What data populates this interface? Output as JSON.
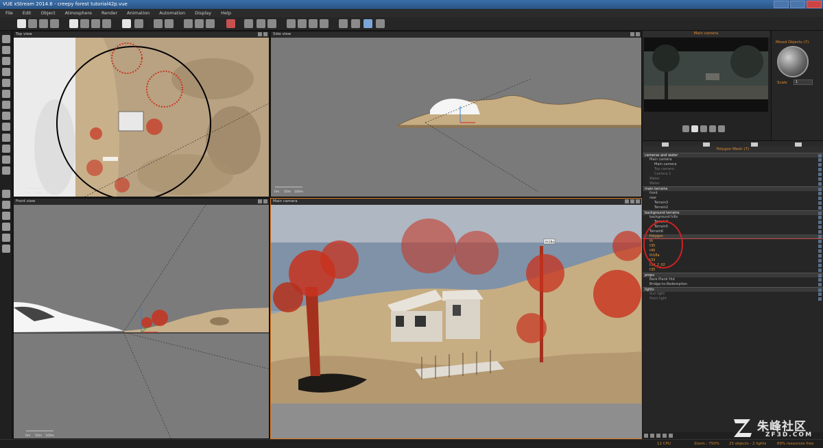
{
  "window": {
    "title": "VUE xStream 2014.6 - creepy forest tutorial42p.vue"
  },
  "menu": [
    "File",
    "Edit",
    "Object",
    "Atmosphere",
    "Render",
    "Animation",
    "Automation",
    "Display",
    "Help"
  ],
  "viewports": {
    "top": {
      "label": "Top view",
      "scale": [
        "0m",
        "50m",
        "100m"
      ]
    },
    "side": {
      "label": "Side view",
      "scale": [
        "0m",
        "50m",
        "100m"
      ]
    },
    "front": {
      "label": "Front view",
      "scale": [
        "0m",
        "50m",
        "100m"
      ]
    },
    "main": {
      "label": "Main camera",
      "object_tag": "th18a"
    }
  },
  "camera_panel": {
    "title": "Main camera"
  },
  "material_panel": {
    "title": "Mixed Objects (7)",
    "scale_label": "Scale",
    "scale_value": "1"
  },
  "object_panel": {
    "title": "Polygon Mesh (7)",
    "rows": [
      {
        "text": "cameras and water",
        "kind": "group",
        "indent": 0
      },
      {
        "text": "Main camera",
        "kind": "item",
        "indent": 1
      },
      {
        "text": "Main camera",
        "kind": "item",
        "indent": 2
      },
      {
        "text": "Top camera",
        "kind": "dim",
        "indent": 2
      },
      {
        "text": "Camera 1",
        "kind": "dim",
        "indent": 2
      },
      {
        "text": "Water",
        "kind": "dim",
        "indent": 1
      },
      {
        "text": "Water",
        "kind": "dim",
        "indent": 1
      },
      {
        "text": "main terrains",
        "kind": "group",
        "indent": 0
      },
      {
        "text": "front",
        "kind": "item",
        "indent": 1
      },
      {
        "text": "rear",
        "kind": "item",
        "indent": 1
      },
      {
        "text": "Terrain3",
        "kind": "item",
        "indent": 2
      },
      {
        "text": "Terrain2",
        "kind": "item",
        "indent": 2
      },
      {
        "text": "background terrains",
        "kind": "group",
        "indent": 0
      },
      {
        "text": "background hills",
        "kind": "item",
        "indent": 1
      },
      {
        "text": "Terrain4",
        "kind": "item",
        "indent": 2
      },
      {
        "text": "Terrain5",
        "kind": "item",
        "indent": 2
      },
      {
        "text": "Terrain6",
        "kind": "item",
        "indent": 1
      },
      {
        "text": "Polygon",
        "kind": "cur",
        "indent": 1
      },
      {
        "text": "th",
        "kind": "sel",
        "indent": 1
      },
      {
        "text": "t35",
        "kind": "sel",
        "indent": 1
      },
      {
        "text": "t40",
        "kind": "sel",
        "indent": 1
      },
      {
        "text": "th18a",
        "kind": "sel",
        "indent": 1
      },
      {
        "text": "t33",
        "kind": "sel",
        "indent": 1
      },
      {
        "text": "t3d_2_02",
        "kind": "sel",
        "indent": 1
      },
      {
        "text": "t35",
        "kind": "sel",
        "indent": 1
      },
      {
        "text": "props",
        "kind": "group",
        "indent": 0
      },
      {
        "text": "Bare Plank Hut",
        "kind": "item",
        "indent": 1
      },
      {
        "text": "Bridge-to-Redemption",
        "kind": "item",
        "indent": 1
      },
      {
        "text": "lights",
        "kind": "group",
        "indent": 0
      },
      {
        "text": "Sun light",
        "kind": "dim",
        "indent": 1
      },
      {
        "text": "Point light",
        "kind": "dim",
        "indent": 1
      }
    ]
  },
  "status": {
    "cpu": "12 CPU",
    "zoom": "Zoom : 750%",
    "objects": "25 objects - 2 lights",
    "resources": "69% resources free"
  },
  "watermark": {
    "cn": "朱峰社区",
    "en": "ZF3D.COM"
  },
  "colors": {
    "accent": "#e07a1f",
    "selection": "#f0a040",
    "annotation": "#d12020",
    "tree_red": "#c8321e"
  }
}
